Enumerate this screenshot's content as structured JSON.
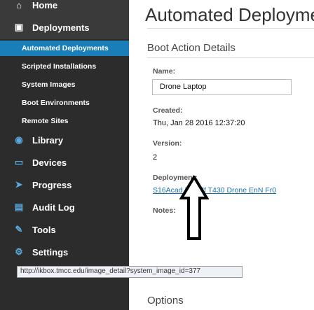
{
  "sidebar": {
    "home": "Home",
    "deployments": "Deployments",
    "sub_items": [
      {
        "label": "Automated Deployments"
      },
      {
        "label": "Scripted Installations"
      },
      {
        "label": "System Images"
      },
      {
        "label": "Boot Environments"
      },
      {
        "label": "Remote Sites"
      }
    ],
    "library": "Library",
    "devices": "Devices",
    "progress": "Progress",
    "audit_log": "Audit Log",
    "tools": "Tools",
    "settings": "Settings"
  },
  "main": {
    "title": "Automated Deployme",
    "section_title": "Boot Action Details",
    "name_label": "Name:",
    "name_value": "Drone Laptop",
    "created_label": "Created:",
    "created_value": "Thu, Jan 28 2016 12:37:20",
    "version_label": "Version:",
    "version_value": "2",
    "deployment_label": "Deployment:",
    "deployment_link": "S16Acad EDVdf T430 Drone EnN Fr0",
    "notes_label": "Notes:",
    "options_title": "Options"
  },
  "statusbar": {
    "url": "http://ikbox.tmcc.edu/image_detail?system_image_id=377"
  },
  "colors": {
    "sidebar_bg": "#2c2c2c",
    "active_bg": "#1a7fb8",
    "link": "#1a6ea8"
  }
}
